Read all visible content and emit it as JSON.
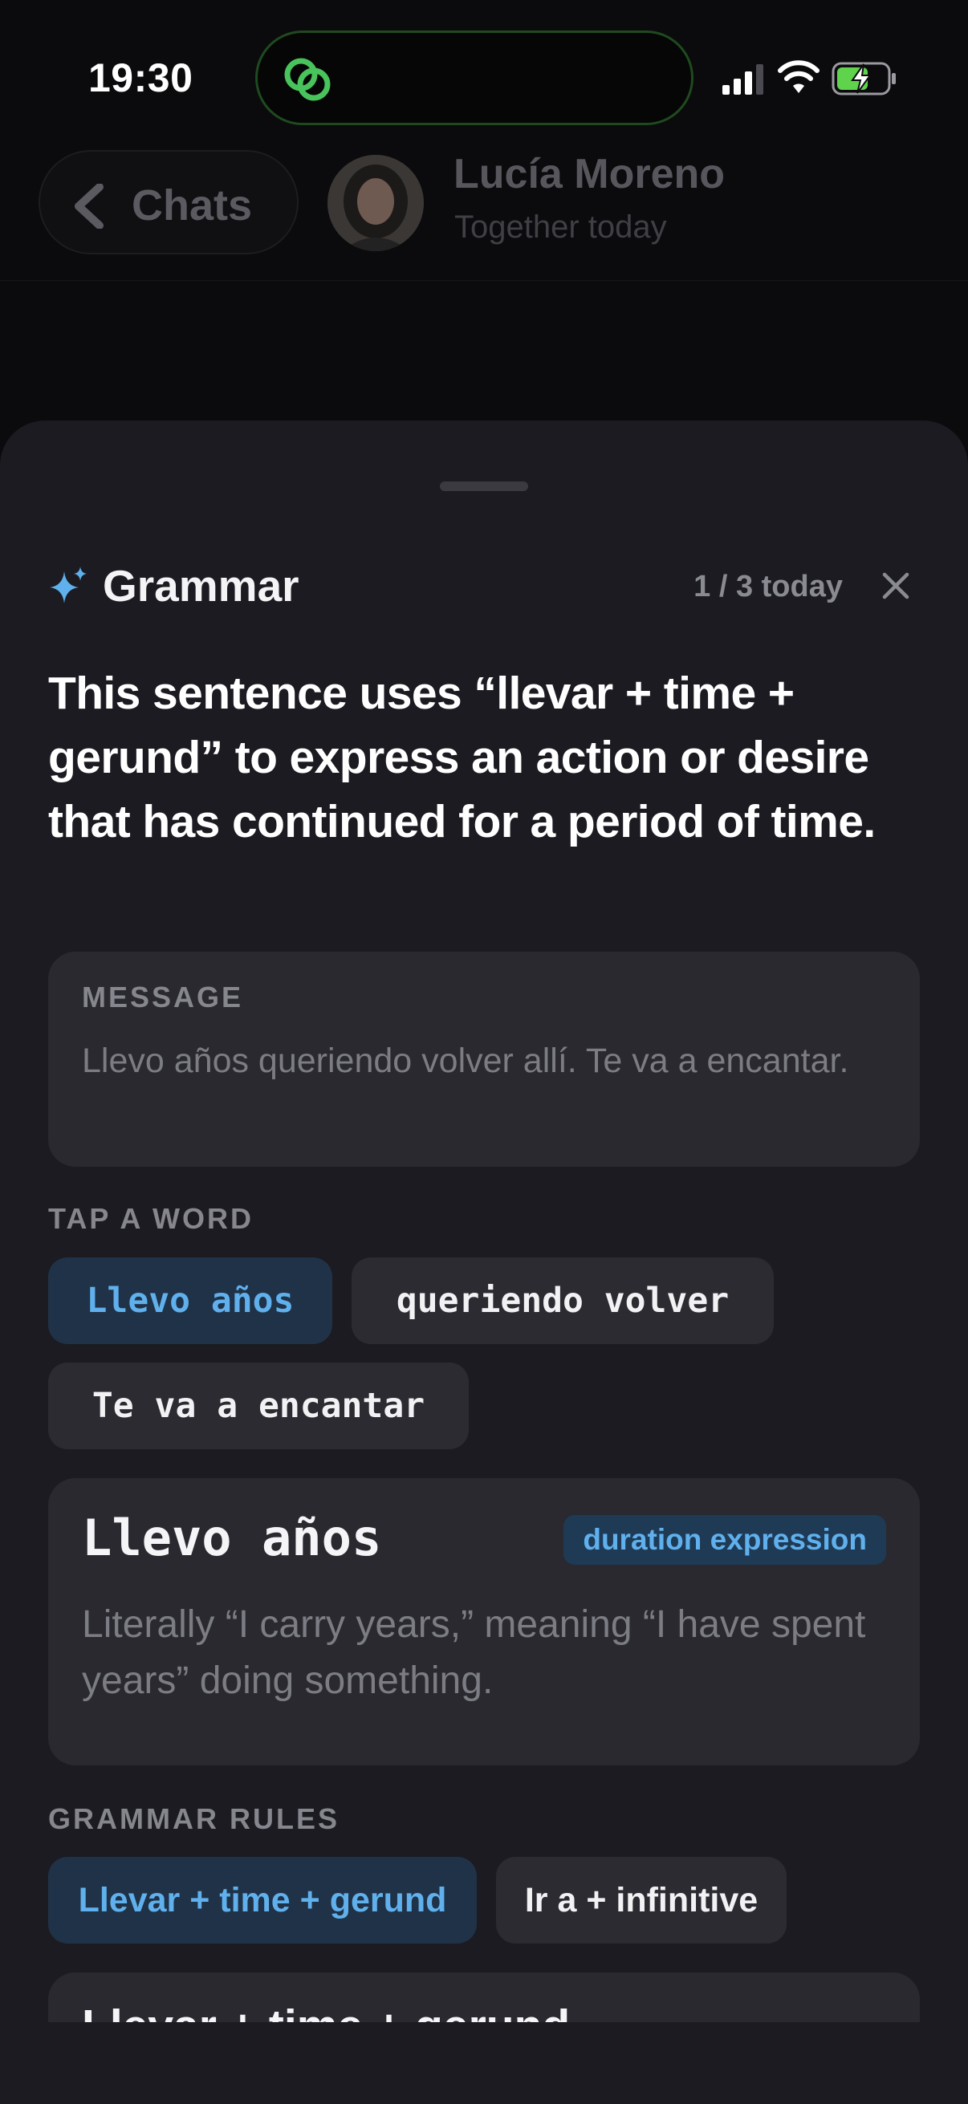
{
  "status_bar": {
    "time": "19:30",
    "island_app_icon": "link-rings-icon",
    "icons": [
      "cellular-signal-icon",
      "wifi-icon",
      "battery-charging-icon"
    ]
  },
  "chat_header": {
    "back_label": "Chats",
    "contact_name": "Lucía Moreno",
    "contact_status": "Together today"
  },
  "sheet": {
    "title": "Grammar",
    "usage": "1 / 3 today",
    "explanation": "This sentence uses “llevar + time + gerund” to express an action or desire that has continued for a period of time.",
    "message": {
      "label": "MESSAGE",
      "text": "Llevo años queriendo volver allí. Te va a encantar."
    },
    "tap_word": {
      "label": "TAP A WORD",
      "chips": [
        {
          "text": "Llevo años",
          "selected": true
        },
        {
          "text": "queriendo volver",
          "selected": false
        },
        {
          "text": "Te va a encantar",
          "selected": false
        }
      ]
    },
    "word_detail": {
      "word": "Llevo años",
      "tag": "duration expression",
      "description": "Literally “I carry years,” meaning “I have spent years” doing something."
    },
    "grammar_rules": {
      "label": "GRAMMAR RULES",
      "chips": [
        {
          "text": "Llevar + time + gerund",
          "selected": true
        },
        {
          "text": "Ir a + infinitive",
          "selected": false
        }
      ],
      "card_title": "Llevar + time + gerund"
    }
  },
  "colors": {
    "accent_blue": "#5fb0ec",
    "sheet_bg": "#1b1b21",
    "card_bg": "#29292f",
    "island_green": "#49c35b"
  }
}
